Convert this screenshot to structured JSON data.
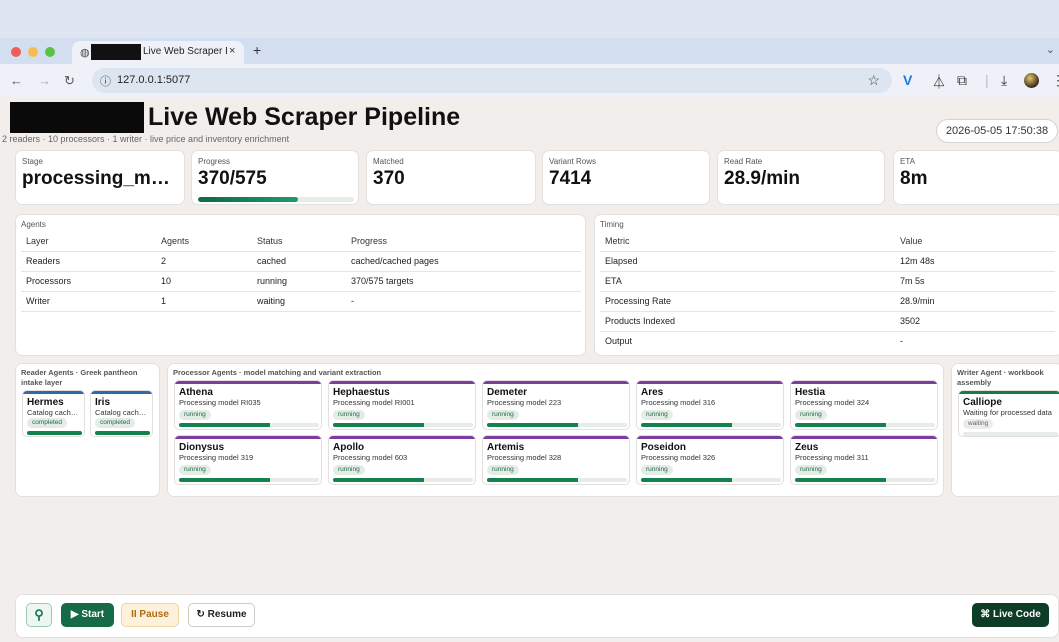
{
  "browser": {
    "tab_title": "Live Web Scraper Pipeline",
    "tab_close": "×",
    "new_tab": "+",
    "url": "127.0.0.1:5077",
    "colors": {
      "close": "#ee5c55",
      "minimize": "#f5bd4f",
      "maximize": "#5cc244"
    }
  },
  "page": {
    "title": "Live Web Scraper Pipeline",
    "subtitle": "2 readers · 10 processors · 1 writer · live price and inventory enrichment",
    "datetime": "2026-05-05 17:50:38"
  },
  "stats": [
    {
      "label": "Stage",
      "value": "processing_m…"
    },
    {
      "label": "Progress",
      "value": "370/575",
      "progress": 0.643
    },
    {
      "label": "Matched",
      "value": "370"
    },
    {
      "label": "Variant Rows",
      "value": "7414"
    },
    {
      "label": "Read Rate",
      "value": "28.9/min"
    },
    {
      "label": "ETA",
      "value": "8m"
    }
  ],
  "agents_panel": {
    "title": "Agents",
    "headers": [
      "Layer",
      "Agents",
      "Status",
      "Progress"
    ],
    "rows": [
      [
        "Readers",
        "2",
        "cached",
        "cached/cached pages"
      ],
      [
        "Processors",
        "10",
        "running",
        "370/575 targets"
      ],
      [
        "Writer",
        "1",
        "waiting",
        "-"
      ]
    ]
  },
  "timing_panel": {
    "title": "Timing",
    "headers": [
      "Metric",
      "Value"
    ],
    "rows": [
      [
        "Elapsed",
        "12m 48s"
      ],
      [
        "ETA",
        "7m 5s"
      ],
      [
        "Processing Rate",
        "28.9/min"
      ],
      [
        "Products Indexed",
        "3502"
      ],
      [
        "Output",
        "-"
      ]
    ]
  },
  "reader_agents": {
    "title": "Reader Agents · Greek pantheon intake layer",
    "accent": "#2f6aa8",
    "agents": [
      {
        "name": "Hermes",
        "desc": "Catalog cach…",
        "status": "completed",
        "progress": 1.0
      },
      {
        "name": "Iris",
        "desc": "Catalog cach…",
        "status": "completed",
        "progress": 1.0
      }
    ]
  },
  "processor_agents": {
    "title": "Processor Agents · model matching and variant extraction",
    "accent": "#7b3da0",
    "agents": [
      {
        "name": "Athena",
        "desc": "Processing model RI035",
        "status": "running",
        "progress": 0.65
      },
      {
        "name": "Hephaestus",
        "desc": "Processing model RI001",
        "status": "running",
        "progress": 0.65
      },
      {
        "name": "Demeter",
        "desc": "Processing model 223",
        "status": "running",
        "progress": 0.65
      },
      {
        "name": "Ares",
        "desc": "Processing model 316",
        "status": "running",
        "progress": 0.65
      },
      {
        "name": "Hestia",
        "desc": "Processing model 324",
        "status": "running",
        "progress": 0.65
      },
      {
        "name": "Dionysus",
        "desc": "Processing model 319",
        "status": "running",
        "progress": 0.65
      },
      {
        "name": "Apollo",
        "desc": "Processing model 603",
        "status": "running",
        "progress": 0.65
      },
      {
        "name": "Artemis",
        "desc": "Processing model 328",
        "status": "running",
        "progress": 0.65
      },
      {
        "name": "Poseidon",
        "desc": "Processing model 326",
        "status": "running",
        "progress": 0.65
      },
      {
        "name": "Zeus",
        "desc": "Processing model 311",
        "status": "running",
        "progress": 0.65
      }
    ]
  },
  "writer_agents": {
    "title": "Writer Agent · workbook assembly",
    "accent": "#1a7a4e",
    "agents": [
      {
        "name": "Calliope",
        "desc": "Waiting for processed data",
        "status": "waiting",
        "progress": 0.0
      }
    ]
  },
  "controls": {
    "start": "▶ Start",
    "pause": "II Pause",
    "resume": "↻ Resume",
    "live_code": "⌘ Live Code"
  }
}
